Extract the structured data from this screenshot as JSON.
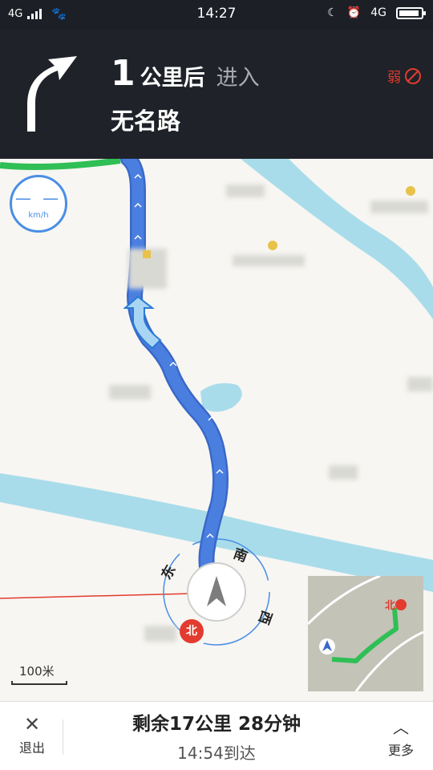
{
  "status_bar": {
    "network": "4G",
    "time": "14:27",
    "network_right": "4G"
  },
  "nav_header": {
    "distance_value": "1",
    "distance_unit": "公里后",
    "action": "进入",
    "road_name": "无名路",
    "gps_signal": "弱"
  },
  "map": {
    "speed_value": "— —",
    "speed_unit": "km/h",
    "compass": {
      "east": "东",
      "south": "南",
      "west": "西"
    },
    "north_badge": "北",
    "scale": "100米",
    "minimap_north": "北"
  },
  "bottom_bar": {
    "exit_label": "退出",
    "summary": "剩余17公里 28分钟",
    "eta": "14:54到达",
    "more_label": "更多"
  },
  "colors": {
    "route": "#4a7fe0",
    "river": "#a9dcea",
    "header_bg": "#1f2329",
    "route_green": "#2fbf55",
    "accent_red": "#e33b2f"
  }
}
